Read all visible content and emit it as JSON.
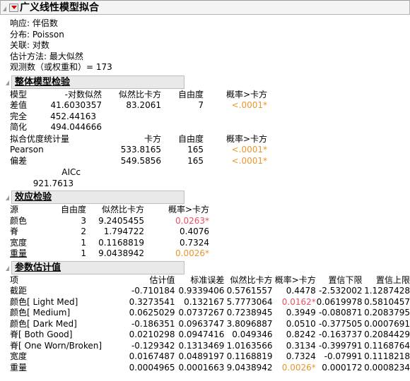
{
  "window": {
    "title": "广义线性模型拟合",
    "disclosure_icon": "triangle-collapse-icon",
    "menu_icon": "red-triangle-menu-icon"
  },
  "meta": {
    "response": "响应: 伴侣数",
    "distribution": "分布: Poisson",
    "link": "关联: 对数",
    "estimation": "估计方法: 最大似然",
    "observations": "观测数（或权重和）= 173"
  },
  "overall_model_test": {
    "title": "整体模型检验",
    "columns": [
      "模型",
      "-对数似然",
      "似然比卡方",
      "自由度",
      "概率>卡方"
    ],
    "rows": [
      {
        "cells": [
          "差值",
          "41.6030357",
          "83.2061",
          "7",
          "<.0001*"
        ],
        "sig": [
          false,
          false,
          false,
          false,
          "orange"
        ]
      },
      {
        "cells": [
          "完全",
          "452.44163",
          "",
          "",
          ""
        ],
        "sig": [
          false,
          false,
          false,
          false,
          false
        ]
      },
      {
        "cells": [
          "简化",
          "494.044666",
          "",
          "",
          ""
        ],
        "sig": [
          false,
          false,
          false,
          false,
          false
        ]
      }
    ],
    "goodness_of_fit": {
      "columns": [
        "拟合优度统计量",
        "卡方",
        "自由度",
        "概率>卡方"
      ],
      "rows": [
        {
          "cells": [
            "Pearson",
            "533.8165",
            "165",
            "<.0001*"
          ],
          "sig": [
            false,
            false,
            false,
            "orange"
          ]
        },
        {
          "cells": [
            "偏差",
            "549.5856",
            "165",
            "<.0001*"
          ],
          "sig": [
            false,
            false,
            false,
            "orange"
          ]
        }
      ]
    },
    "aicc": {
      "label": "AICc",
      "value": "921.7613"
    }
  },
  "effect_tests": {
    "title": "效应检验",
    "columns": [
      "源",
      "自由度",
      "似然比卡方",
      "概率>卡方"
    ],
    "rows": [
      {
        "cells": [
          "颜色",
          "3",
          "9.2405455",
          "0.0263*"
        ],
        "sig": [
          false,
          false,
          false,
          "red"
        ]
      },
      {
        "cells": [
          "脊",
          "2",
          "1.794722",
          "0.4076"
        ],
        "sig": [
          false,
          false,
          false,
          false
        ]
      },
      {
        "cells": [
          "宽度",
          "1",
          "0.1168819",
          "0.7324"
        ],
        "sig": [
          false,
          false,
          false,
          false
        ]
      },
      {
        "cells": [
          "重量",
          "1",
          "9.0438942",
          "0.0026*"
        ],
        "sig": [
          false,
          false,
          false,
          "orange"
        ]
      }
    ]
  },
  "parameter_estimates": {
    "title": "参数估计值",
    "columns": [
      "项",
      "估计值",
      "标准误差",
      "似然比卡方",
      "概率>卡方",
      "置信下限",
      "置信上限"
    ],
    "rows": [
      {
        "cells": [
          "截距",
          "-0.710184",
          "0.9339406",
          "0.5761557",
          "0.4478",
          "-2.532002",
          "1.1287428"
        ],
        "sig": [
          false,
          false,
          false,
          false,
          false,
          false,
          false
        ]
      },
      {
        "cells": [
          "颜色[ Light Med]",
          "0.3273541",
          "0.132167",
          "5.7773064",
          "0.0162*",
          "0.0619978",
          "0.5810457"
        ],
        "sig": [
          false,
          false,
          false,
          false,
          "red",
          false,
          false
        ]
      },
      {
        "cells": [
          "颜色[ Medium]",
          "0.0625029",
          "0.0737267",
          "0.7238945",
          "0.3949",
          "-0.080871",
          "0.2083795"
        ],
        "sig": [
          false,
          false,
          false,
          false,
          false,
          false,
          false
        ]
      },
      {
        "cells": [
          "颜色[ Dark Med]",
          "-0.186351",
          "0.0963747",
          "3.8096887",
          "0.0510",
          "-0.377505",
          "0.0007691"
        ],
        "sig": [
          false,
          false,
          false,
          false,
          false,
          false,
          false
        ]
      },
      {
        "cells": [
          "脊[ Both Good]",
          "0.0210298",
          "0.0947416",
          "0.049346",
          "0.8242",
          "-0.163737",
          "0.2084429"
        ],
        "sig": [
          false,
          false,
          false,
          false,
          false,
          false,
          false
        ]
      },
      {
        "cells": [
          "脊[ One Worn/Broken]",
          "-0.129342",
          "0.1313469",
          "1.0163566",
          "0.3134",
          "-0.399791",
          "0.1168764"
        ],
        "sig": [
          false,
          false,
          false,
          false,
          false,
          false,
          false
        ]
      },
      {
        "cells": [
          "宽度",
          "0.0167487",
          "0.0489197",
          "0.1168819",
          "0.7324",
          "-0.07991",
          "0.1118218"
        ],
        "sig": [
          false,
          false,
          false,
          false,
          false,
          false,
          false
        ]
      },
      {
        "cells": [
          "重量",
          "0.0004965",
          "0.0001663",
          "9.0438942",
          "0.0026*",
          "0.000172",
          "0.0008234"
        ],
        "sig": [
          false,
          false,
          false,
          false,
          "orange",
          false,
          false
        ]
      }
    ]
  },
  "colors": {
    "significant_red": "#ec4d62",
    "significant_orange": "#e8962c",
    "header_bg": "#e9e9e9",
    "titlebar_bg": "#f4f4f4",
    "border": "#bdbdbd"
  }
}
